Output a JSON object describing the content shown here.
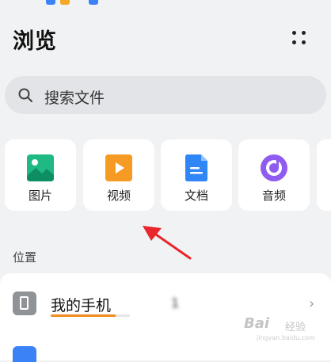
{
  "header": {
    "title": "浏览"
  },
  "search": {
    "placeholder": "搜索文件"
  },
  "categories": [
    {
      "label": "图片",
      "icon": "image-icon",
      "color": "#1fb983"
    },
    {
      "label": "视频",
      "icon": "video-icon",
      "color": "#f59a23"
    },
    {
      "label": "文档",
      "icon": "document-icon",
      "color": "#2f86f6"
    },
    {
      "label": "音频",
      "icon": "audio-icon",
      "color": "#8f5bf0"
    }
  ],
  "locations": {
    "section_title": "位置",
    "items": [
      {
        "name": "我的手机",
        "icon": "phone-icon",
        "storage_text": "1",
        "storage_used_fraction": 0.82,
        "accent": "#f08a1e"
      }
    ]
  },
  "annotation": {
    "arrow_color": "#e8262c"
  },
  "watermark": {
    "brand": "Bai",
    "sub": "经验",
    "url": "jingyan.baidu.com"
  }
}
